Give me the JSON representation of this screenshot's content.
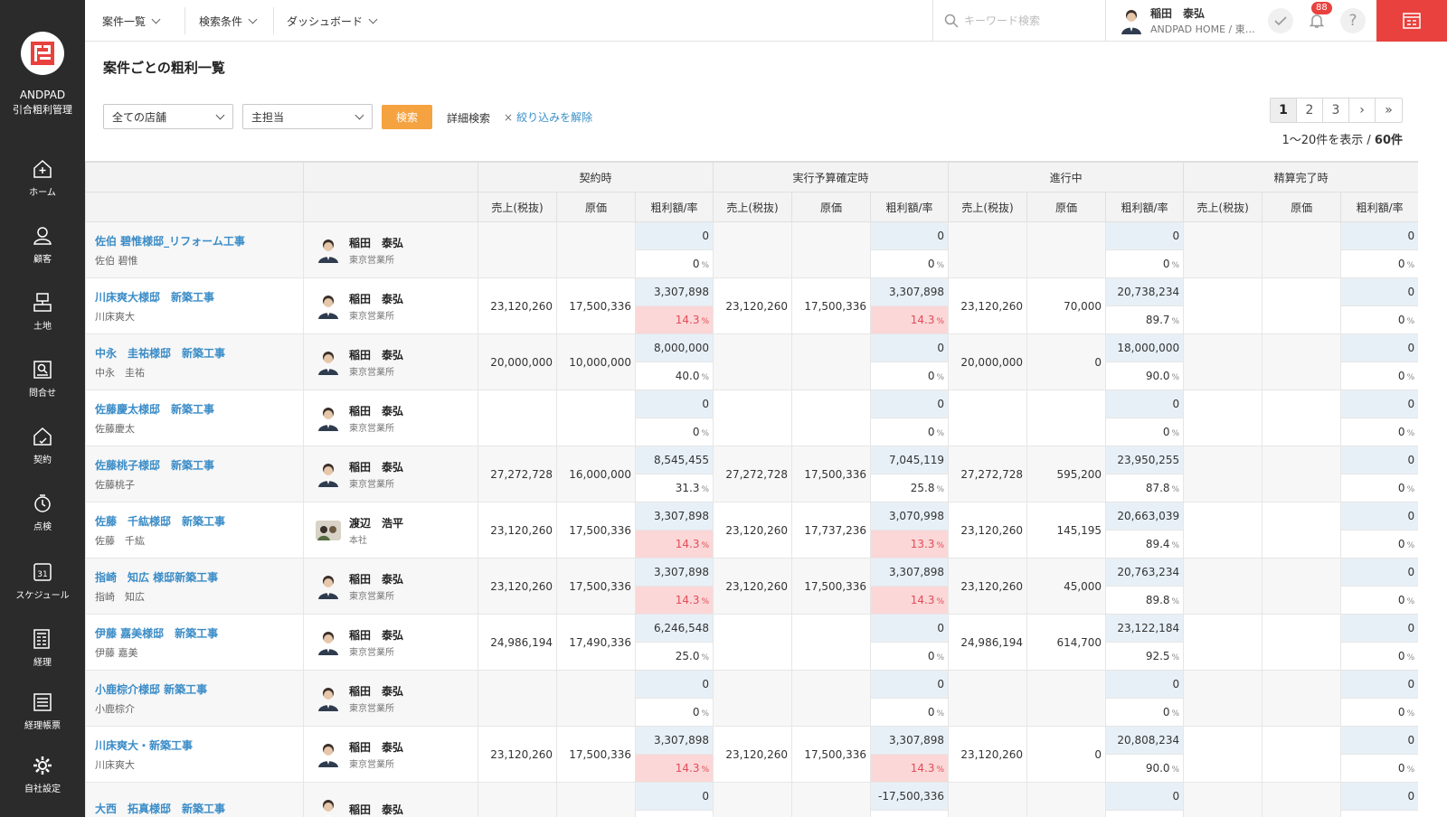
{
  "sidebar": {
    "brand": "ANDPAD",
    "brand_sub": "引合粗利管理",
    "items": [
      {
        "label": "ホーム",
        "icon": "home-icon"
      },
      {
        "label": "顧客",
        "icon": "customer-icon"
      },
      {
        "label": "土地",
        "icon": "land-icon"
      },
      {
        "label": "問合せ",
        "icon": "inquiry-icon"
      },
      {
        "label": "契約",
        "icon": "contract-icon"
      },
      {
        "label": "点検",
        "icon": "inspection-icon"
      },
      {
        "label": "スケジュール",
        "icon": "calendar-icon"
      },
      {
        "label": "経理",
        "icon": "accounting-icon"
      },
      {
        "label": "経理帳票",
        "icon": "report-icon"
      },
      {
        "label": "自社設定",
        "icon": "gear-icon"
      }
    ],
    "calendar_day": "31"
  },
  "header": {
    "menus": [
      "案件一覧",
      "検索条件",
      "ダッシュボード"
    ],
    "search_placeholder": "キーワード検索",
    "user_name": "稲田　泰弘",
    "user_company": "ANDPAD HOME / 東…",
    "notification_count": "88",
    "help": "?"
  },
  "page": {
    "title": "案件ごとの粗利一覧",
    "store_select": "全ての店舗",
    "owner_select": "主担当",
    "search_button": "検索",
    "detail_search": "詳細検索",
    "clear_filter": "絞り込みを解除",
    "clear_x": "×",
    "pages": [
      "1",
      "2",
      "3",
      "›",
      "»"
    ],
    "count_prefix": "1〜20件を表示 / ",
    "count_total": "60件"
  },
  "table": {
    "groups": [
      "契約時",
      "実行予算確定時",
      "進行中",
      "精算完了時"
    ],
    "subheaders": [
      "売上(税抜)",
      "原価",
      "粗利額/率"
    ],
    "rows": [
      {
        "project": "佐伯 碧惟様邸_リフォーム工事",
        "customer": "佐伯 碧惟",
        "emp": "稲田　泰弘",
        "office": "東京営業所",
        "s1": "",
        "c1": "",
        "g1": "0",
        "r1": "0",
        "p1": false,
        "s2": "",
        "c2": "",
        "g2": "0",
        "r2": "0",
        "p2": false,
        "s3": "",
        "c3": "",
        "g3": "0",
        "r3": "0",
        "p3": false,
        "g4": "0",
        "r4": "0"
      },
      {
        "project": "川床爽大様邸　新築工事",
        "customer": "川床爽大",
        "emp": "稲田　泰弘",
        "office": "東京営業所",
        "s1": "23,120,260",
        "c1": "17,500,336",
        "g1": "3,307,898",
        "r1": "14.3",
        "p1": true,
        "s2": "23,120,260",
        "c2": "17,500,336",
        "g2": "3,307,898",
        "r2": "14.3",
        "p2": true,
        "s3": "23,120,260",
        "c3": "70,000",
        "g3": "20,738,234",
        "r3": "89.7",
        "p3": false,
        "g4": "0",
        "r4": "0"
      },
      {
        "project": "中永　圭祐様邸　新築工事",
        "customer": "中永　圭祐",
        "emp": "稲田　泰弘",
        "office": "東京営業所",
        "s1": "20,000,000",
        "c1": "10,000,000",
        "g1": "8,000,000",
        "r1": "40.0",
        "p1": false,
        "s2": "",
        "c2": "",
        "g2": "0",
        "r2": "0",
        "p2": false,
        "s3": "20,000,000",
        "c3": "0",
        "g3": "18,000,000",
        "r3": "90.0",
        "p3": false,
        "g4": "0",
        "r4": "0"
      },
      {
        "project": "佐藤慶太様邸　新築工事",
        "customer": "佐藤慶太",
        "emp": "稲田　泰弘",
        "office": "東京営業所",
        "s1": "",
        "c1": "",
        "g1": "0",
        "r1": "0",
        "p1": false,
        "s2": "",
        "c2": "",
        "g2": "0",
        "r2": "0",
        "p2": false,
        "s3": "",
        "c3": "",
        "g3": "0",
        "r3": "0",
        "p3": false,
        "g4": "0",
        "r4": "0"
      },
      {
        "project": "佐藤桃子様邸　新築工事",
        "customer": "佐藤桃子",
        "emp": "稲田　泰弘",
        "office": "東京営業所",
        "s1": "27,272,728",
        "c1": "16,000,000",
        "g1": "8,545,455",
        "r1": "31.3",
        "p1": false,
        "s2": "27,272,728",
        "c2": "17,500,336",
        "g2": "7,045,119",
        "r2": "25.8",
        "p2": false,
        "s3": "27,272,728",
        "c3": "595,200",
        "g3": "23,950,255",
        "r3": "87.8",
        "p3": false,
        "g4": "0",
        "r4": "0"
      },
      {
        "project": "佐藤　千紘様邸　新築工事",
        "customer": "佐藤　千紘",
        "emp": "渡辺　浩平",
        "office": "本社",
        "s1": "23,120,260",
        "c1": "17,500,336",
        "g1": "3,307,898",
        "r1": "14.3",
        "p1": true,
        "s2": "23,120,260",
        "c2": "17,737,236",
        "g2": "3,070,998",
        "r2": "13.3",
        "p2": true,
        "s3": "23,120,260",
        "c3": "145,195",
        "g3": "20,663,039",
        "r3": "89.4",
        "p3": false,
        "g4": "0",
        "r4": "0"
      },
      {
        "project": "指崎　知広 様邸新築工事",
        "customer": "指崎　知広",
        "emp": "稲田　泰弘",
        "office": "東京営業所",
        "s1": "23,120,260",
        "c1": "17,500,336",
        "g1": "3,307,898",
        "r1": "14.3",
        "p1": true,
        "s2": "23,120,260",
        "c2": "17,500,336",
        "g2": "3,307,898",
        "r2": "14.3",
        "p2": true,
        "s3": "23,120,260",
        "c3": "45,000",
        "g3": "20,763,234",
        "r3": "89.8",
        "p3": false,
        "g4": "0",
        "r4": "0"
      },
      {
        "project": "伊藤 嘉美様邸　新築工事",
        "customer": "伊藤 嘉美",
        "emp": "稲田　泰弘",
        "office": "東京営業所",
        "s1": "24,986,194",
        "c1": "17,490,336",
        "g1": "6,246,548",
        "r1": "25.0",
        "p1": false,
        "s2": "",
        "c2": "",
        "g2": "0",
        "r2": "0",
        "p2": false,
        "s3": "24,986,194",
        "c3": "614,700",
        "g3": "23,122,184",
        "r3": "92.5",
        "p3": false,
        "g4": "0",
        "r4": "0"
      },
      {
        "project": "小鹿棕介様邸 新築工事",
        "customer": "小鹿棕介",
        "emp": "稲田　泰弘",
        "office": "東京営業所",
        "s1": "",
        "c1": "",
        "g1": "0",
        "r1": "0",
        "p1": false,
        "s2": "",
        "c2": "",
        "g2": "0",
        "r2": "0",
        "p2": false,
        "s3": "",
        "c3": "",
        "g3": "0",
        "r3": "0",
        "p3": false,
        "g4": "0",
        "r4": "0"
      },
      {
        "project": "川床爽大・新築工事",
        "customer": "川床爽大",
        "emp": "稲田　泰弘",
        "office": "東京営業所",
        "s1": "23,120,260",
        "c1": "17,500,336",
        "g1": "3,307,898",
        "r1": "14.3",
        "p1": true,
        "s2": "23,120,260",
        "c2": "17,500,336",
        "g2": "3,307,898",
        "r2": "14.3",
        "p2": true,
        "s3": "23,120,260",
        "c3": "0",
        "g3": "20,808,234",
        "r3": "90.0",
        "p3": false,
        "g4": "0",
        "r4": "0"
      },
      {
        "project": "大西　拓真様邸　新築工事",
        "customer": "",
        "emp": "稲田　泰弘",
        "office": "",
        "s1": "",
        "c1": "",
        "g1": "0",
        "r1": "",
        "p1": false,
        "s2": "",
        "c2": "",
        "g2": "-17,500,336",
        "r2": "",
        "p2": false,
        "s3": "",
        "c3": "",
        "g3": "0",
        "r3": "",
        "p3": false,
        "g4": "0",
        "r4": ""
      }
    ],
    "pct": "%"
  },
  "colors": {
    "accent": "#3a8cc7",
    "brand_red": "#e8413e",
    "search_orange": "#f5a240",
    "pink": "#fbd7d8",
    "blue_cell": "#e8f0f7",
    "sidebar": "#2b2b2b"
  }
}
